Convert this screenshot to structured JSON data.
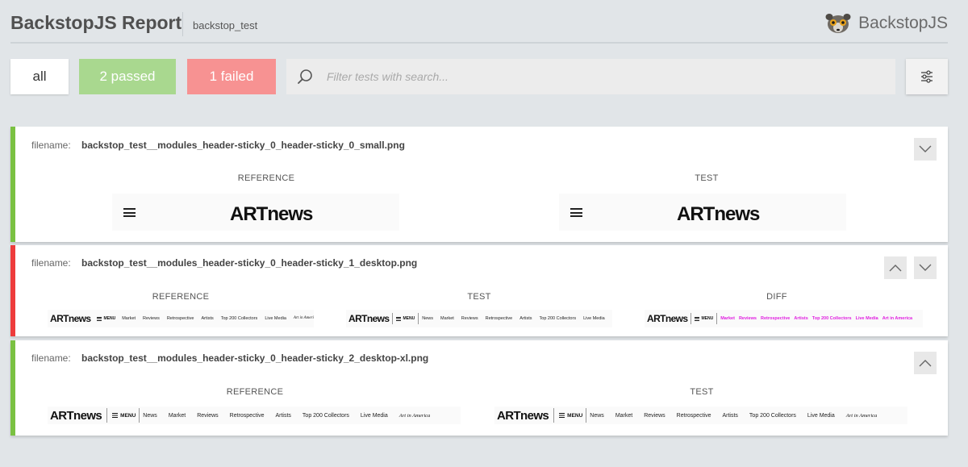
{
  "header": {
    "title": "BackstopJS Report",
    "suite": "backstop_test",
    "brand": "BackstopJS"
  },
  "toolbar": {
    "all_label": "all",
    "passed_label": "2 passed",
    "failed_label": "1 failed",
    "search_placeholder": "Filter tests with search...",
    "colors": {
      "passed": "#a9d88f",
      "failed": "#f79292"
    }
  },
  "labels": {
    "filename": "filename:",
    "reference": "REFERENCE",
    "test": "TEST",
    "diff": "DIFF"
  },
  "site": {
    "logo": "ARTnews",
    "menu": "MENU",
    "nav_items": [
      "News",
      "Market",
      "Reviews",
      "Retrospective",
      "Artists",
      "Top 200 Collectors",
      "Live Media"
    ],
    "partner": "Art in America"
  },
  "tests": [
    {
      "filename": "backstop_test__modules_header-sticky_0_header-sticky_0_small.png",
      "status": "pass"
    },
    {
      "filename": "backstop_test__modules_header-sticky_0_header-sticky_1_desktop.png",
      "status": "fail"
    },
    {
      "filename": "backstop_test__modules_header-sticky_0_header-sticky_2_desktop-xl.png",
      "status": "pass"
    }
  ],
  "icons": {
    "search": "search-icon",
    "settings": "sliders-icon",
    "expand": "chevron-down-icon",
    "collapse": "chevron-up-icon",
    "brand": "lemur-logo-icon"
  }
}
